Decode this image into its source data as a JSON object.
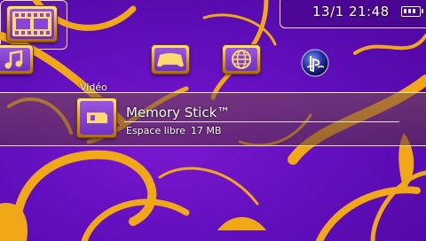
{
  "status": {
    "date_time": "13/1 21:48",
    "battery_level": 1.0
  },
  "xmb": {
    "categories": [
      {
        "id": "music",
        "icon": "music-note-icon"
      },
      {
        "id": "video",
        "label": "Vidéo",
        "icon": "film-icon",
        "selected": true
      },
      {
        "id": "game",
        "icon": "gamepad-icon"
      },
      {
        "id": "network",
        "icon": "globe-icon"
      },
      {
        "id": "playstation-network",
        "icon": "psn-logo-icon"
      }
    ]
  },
  "memory_stick": {
    "title": "Memory Stick™",
    "free_label": "Espace libre",
    "free_value": "17 MB"
  },
  "colors": {
    "background": "#5a0aa8",
    "accent": "#f0a818",
    "highlight_line": "#f5e6a0"
  }
}
